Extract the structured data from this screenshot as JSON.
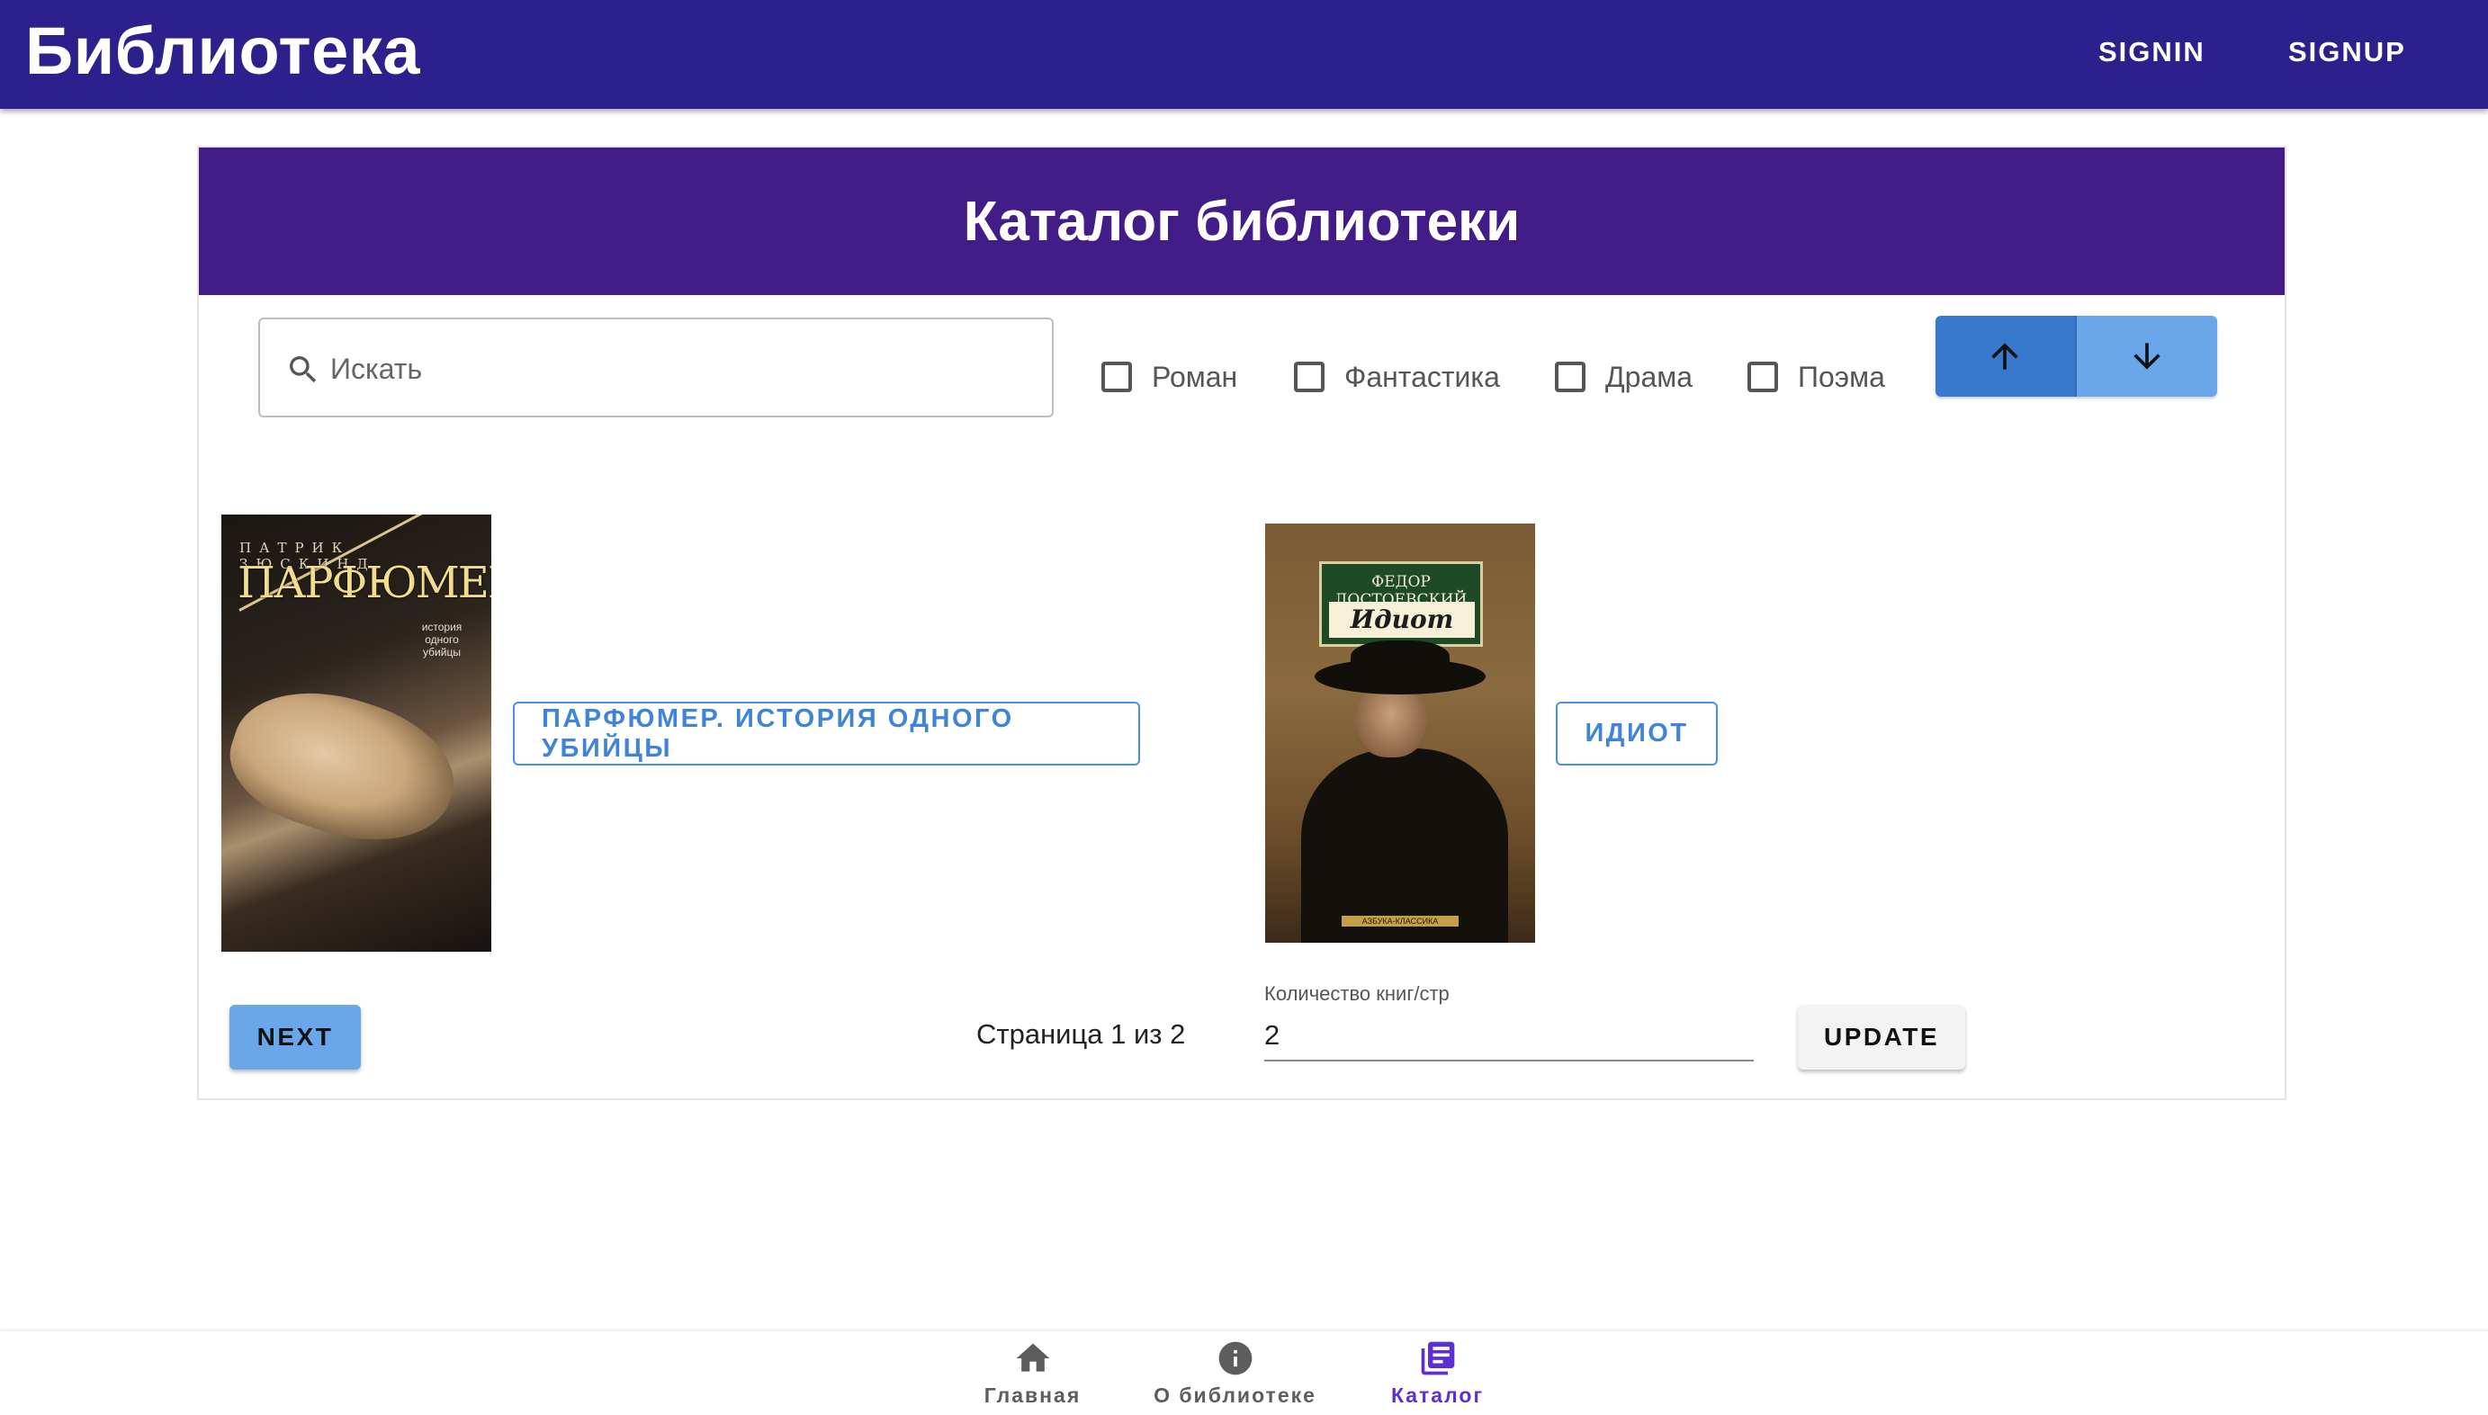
{
  "appbar": {
    "brand": "Библиотека",
    "signin": "SIGNIN",
    "signup": "SIGNUP",
    "color": "#2c218c"
  },
  "catalog": {
    "title": "Каталог библиотеки",
    "header_color": "#421c87",
    "search": {
      "placeholder": "Искать",
      "value": "",
      "icon": "search-icon"
    },
    "genres": [
      {
        "label": "Роман",
        "checked": false
      },
      {
        "label": "Фантастика",
        "checked": false
      },
      {
        "label": "Драма",
        "checked": false
      },
      {
        "label": "Поэма",
        "checked": false
      }
    ],
    "sort": {
      "asc_icon": "arrow-up-icon",
      "desc_icon": "arrow-down-icon",
      "active": "asc"
    },
    "books": [
      {
        "title_button": "ПАРФЮМЕР. ИСТОРИЯ ОДНОГО УБИЙЦЫ",
        "cover": {
          "author": "ПАТРИК ЗЮСКИНД",
          "title": "ПАРФЮМЕР",
          "subtitle": "история одного убийцы"
        }
      },
      {
        "title_button": "ИДИОТ",
        "cover": {
          "author": "ФЕДОР ДОСТОЕВСКИЙ",
          "title": "Идиот",
          "publisher": "АЗБУКА-КЛАССИКА"
        }
      }
    ],
    "pagination": {
      "next_label": "NEXT",
      "page_info": "Страница 1 из 2",
      "per_page_label": "Количество книг/стр",
      "per_page_value": "2",
      "update_label": "UPDATE"
    }
  },
  "bottom_nav": {
    "items": [
      {
        "label": "Главная",
        "icon": "home-icon",
        "active": false
      },
      {
        "label": "О библиотеке",
        "icon": "info-icon",
        "active": false
      },
      {
        "label": "Каталог",
        "icon": "library-books-icon",
        "active": true
      }
    ],
    "active_color": "#5b2fd1"
  }
}
